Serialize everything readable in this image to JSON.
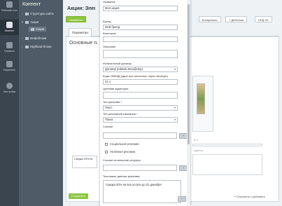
{
  "rail": {
    "items": [
      {
        "label": "Рабочий стол",
        "icon": "desktop-icon"
      },
      {
        "label": "Контент",
        "icon": "content-icon"
      },
      {
        "label": "Сервисы",
        "icon": "services-icon"
      },
      {
        "label": "Маркетинг",
        "icon": "marketing-icon"
      },
      {
        "label": "Настройки",
        "icon": "settings-icon"
      }
    ]
  },
  "sidebar": {
    "title": "Контент",
    "items": [
      {
        "label": "Структура сайта"
      },
      {
        "label": "Акции"
      },
      {
        "label": "Акции"
      },
      {
        "label": "Инфоблоки"
      },
      {
        "label": "Highload-блоки"
      }
    ]
  },
  "page": {
    "title": "Акции: Элем",
    "toolbar": {
      "elements": "Элементы",
      "copy": "Копировать",
      "actions": "+ Действия",
      "ord": "ОРД VK"
    },
    "tabs": {
      "params": "Параметры"
    },
    "section": "Основные па",
    "desc_text": "Скидка 20% на",
    "right_notes": {
      "edit": "едактор",
      "count": "из 1"
    },
    "save": "Сохранить",
    "save_add": "+ Сохранить и добавить"
  },
  "form": {
    "name_label": "Название",
    "name_value": "Моя акция",
    "brand_label": "Бренд",
    "brand_value": "Мой бренд",
    "category_label": "Категория",
    "category_value": "",
    "description_label": "Описание",
    "description_value": "",
    "contract_label": "Изначальный договор",
    "contract_value": "Договор (ediweb.ttoru@dnp)",
    "okved_label": "Коды ОКВЭД (один или несколько через запятую)",
    "okved_value": "21.1",
    "audience_label": "Целевая аудитория",
    "audience_value": "",
    "creative_type_label": "Тип креатива *",
    "creative_type_value": "Текст",
    "campaign_type_label": "Тип рекламной кампании *",
    "campaign_type_value": "Показ",
    "links_label": "Ссылки",
    "links_value": "",
    "social_label": "Социальная реклама",
    "native_label": "Нативная реклама",
    "external_links_label": "Ссылки на внешние ресурсы",
    "external_links_value": "",
    "text_data_label": "Текстовые данные креатива",
    "text_data_value": "Скидка 20% на все услуги до 31 декабря",
    "add_button": "+"
  }
}
